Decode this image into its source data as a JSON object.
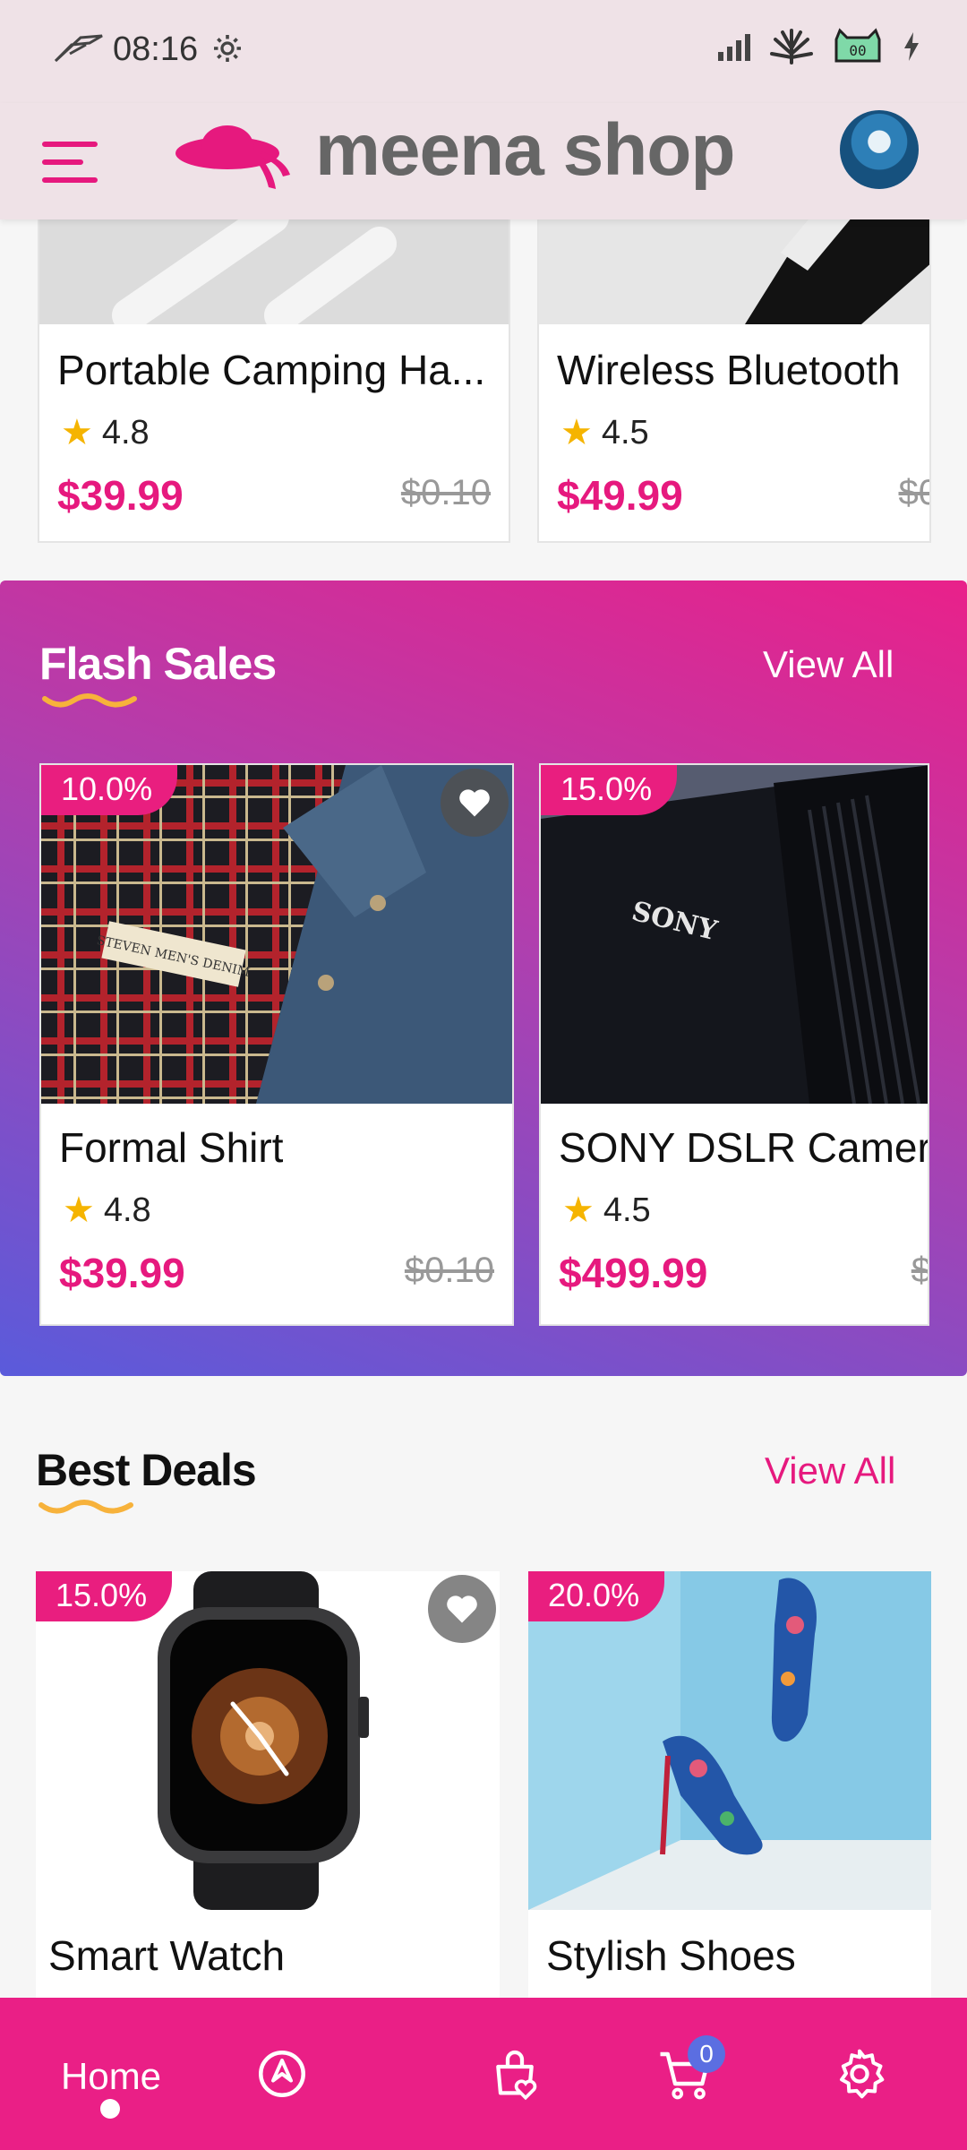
{
  "status_bar": {
    "time": "08:16"
  },
  "header": {
    "brand": "meena shop"
  },
  "top_row": [
    {
      "title": "Portable Camping Ha...",
      "rating": "4.8",
      "price": "$39.99",
      "old_price": "$0.10"
    },
    {
      "title": "Wireless Bluetooth",
      "rating": "4.5",
      "price": "$49.99",
      "old_price": "$0"
    }
  ],
  "flash_sales": {
    "title": "Flash Sales",
    "view_all": "View All",
    "items": [
      {
        "discount": "10.0%",
        "title": "Formal Shirt",
        "rating": "4.8",
        "price": "$39.99",
        "old_price": "$0.10"
      },
      {
        "discount": "15.0%",
        "title": "SONY DSLR Camera",
        "rating": "4.5",
        "price": "$499.99",
        "old_price": "$"
      }
    ],
    "lens_brand": "SONY",
    "shirt_label": "STEVEN MEN'S DENIM"
  },
  "best_deals": {
    "title": "Best Deals",
    "view_all": "View All",
    "items": [
      {
        "discount": "15.0%",
        "title": "Smart Watch"
      },
      {
        "discount": "20.0%",
        "title": "Stylish Shoes"
      }
    ]
  },
  "bottom_nav": {
    "home_label": "Home",
    "cart_count": "0"
  },
  "colors": {
    "accent": "#e91e7f",
    "star": "#f5b400",
    "header_bg": "#efe2e7",
    "badge": "#5b6ee1",
    "underline": "#f7b23b"
  }
}
